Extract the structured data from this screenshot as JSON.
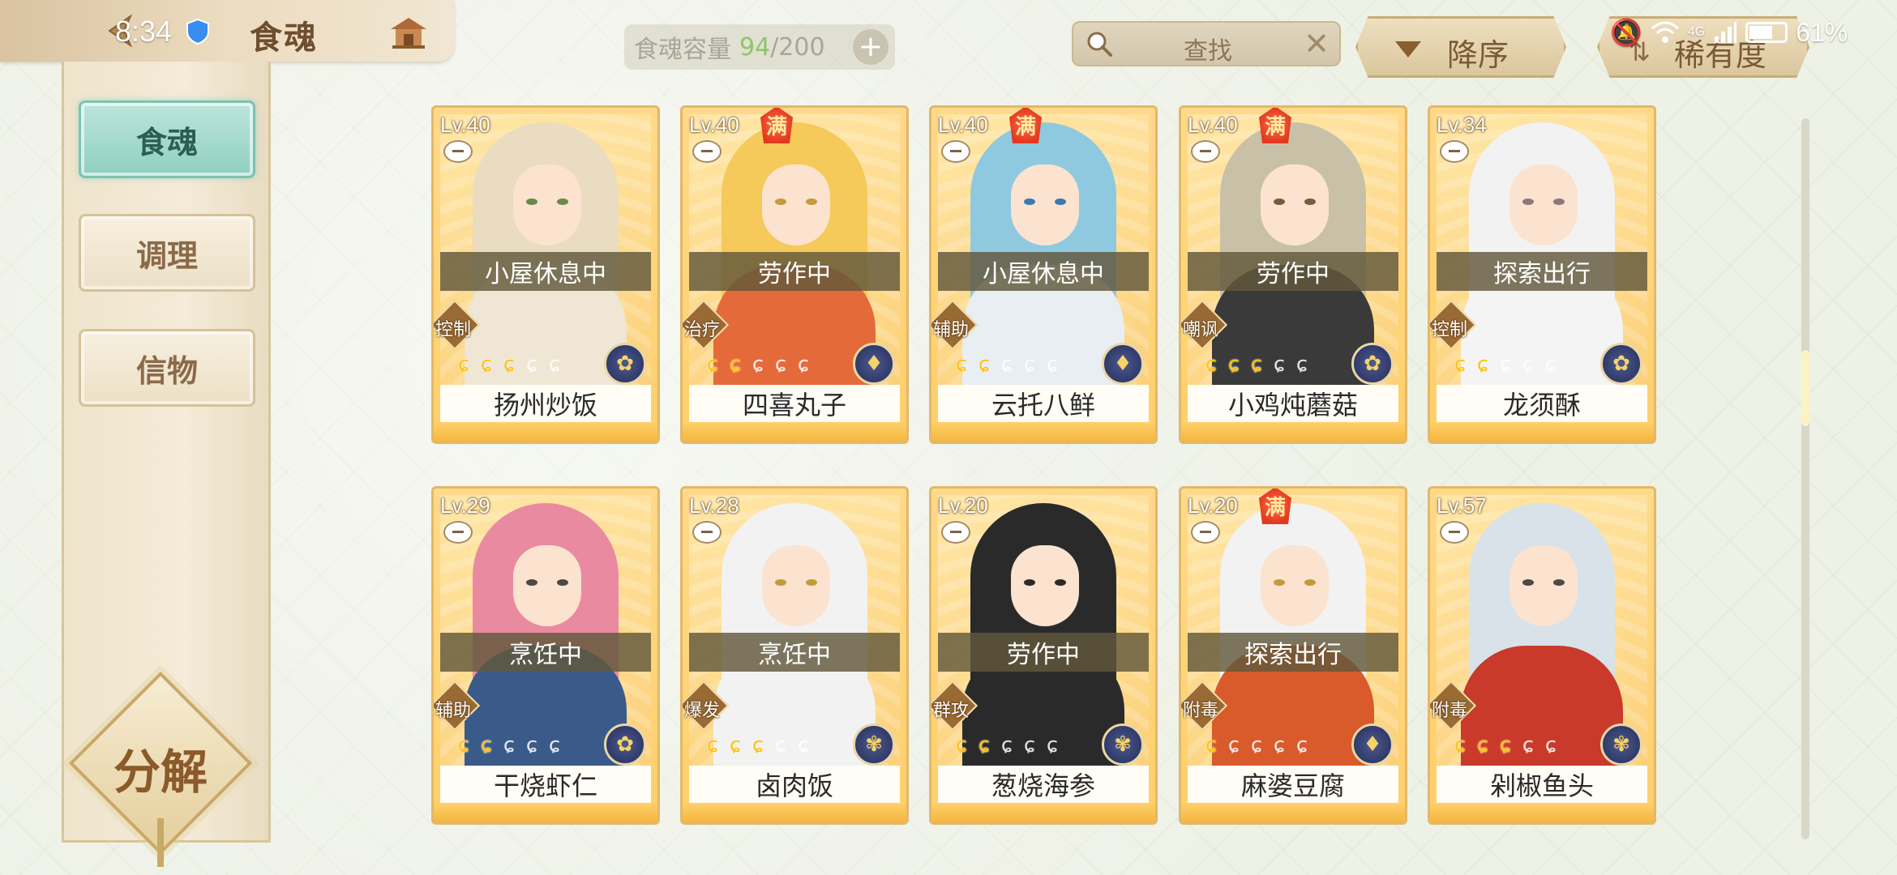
{
  "status_bar": {
    "time": "8:34",
    "network": "4G",
    "battery": "61%"
  },
  "header": {
    "title": "食魂",
    "capacity_label": "食魂容量",
    "capacity_current": "94",
    "capacity_max": "/200",
    "capacity_add": "+",
    "search_placeholder": "查找",
    "search_clear": "✕",
    "sort_label": "降序",
    "rarity_label": "稀有度"
  },
  "sidebar": {
    "tabs": [
      {
        "label": "食魂",
        "active": true
      },
      {
        "label": "调理",
        "active": false
      },
      {
        "label": "信物",
        "active": false
      }
    ],
    "decompose_label": "分解"
  },
  "cards": [
    {
      "level": "Lv.40",
      "status": "小屋休息中",
      "role": "控制",
      "name": "扬州炒饭",
      "max": false,
      "stars": 3,
      "element": "nightshade"
    },
    {
      "level": "Lv.40",
      "status": "劳作中",
      "role": "治疗",
      "name": "四喜丸子",
      "max": true,
      "max_label": "满",
      "stars": 2,
      "element": "flame"
    },
    {
      "level": "Lv.40",
      "status": "小屋休息中",
      "role": "辅助",
      "name": "云托八鲜",
      "max": true,
      "max_label": "满",
      "stars": 2,
      "element": "flame"
    },
    {
      "level": "Lv.40",
      "status": "劳作中",
      "role": "嘲讽",
      "name": "小鸡炖蘑菇",
      "max": true,
      "max_label": "满",
      "stars": 3,
      "element": "nightshade"
    },
    {
      "level": "Lv.34",
      "status": "探索出行",
      "role": "控制",
      "name": "龙须酥",
      "max": false,
      "stars": 2,
      "element": "nightshade"
    },
    {
      "level": "Lv.29",
      "status": "烹饪中",
      "role": "辅助",
      "name": "干烧虾仁",
      "max": false,
      "stars": 2,
      "element": "nightshade"
    },
    {
      "level": "Lv.28",
      "status": "烹饪中",
      "role": "爆发",
      "name": "卤肉饭",
      "max": false,
      "stars": 3,
      "element": "plum"
    },
    {
      "level": "Lv.20",
      "status": "劳作中",
      "role": "群攻",
      "name": "葱烧海参",
      "max": false,
      "stars": 2,
      "element": "plum"
    },
    {
      "level": "Lv.20",
      "status": "探索出行",
      "role": "附毒",
      "name": "麻婆豆腐",
      "max": true,
      "max_label": "满",
      "stars": 1,
      "element": "flame"
    },
    {
      "level": "Lv.57",
      "status": "",
      "role": "附毒",
      "name": "剁椒鱼头",
      "max": false,
      "stars": 3,
      "element": "plum"
    }
  ],
  "colors": {
    "accent_teal": "#8fcfc2",
    "card_gold": "#ffcf6a",
    "capacity_green": "#8fc46a",
    "max_badge_red": "#e23a20"
  }
}
